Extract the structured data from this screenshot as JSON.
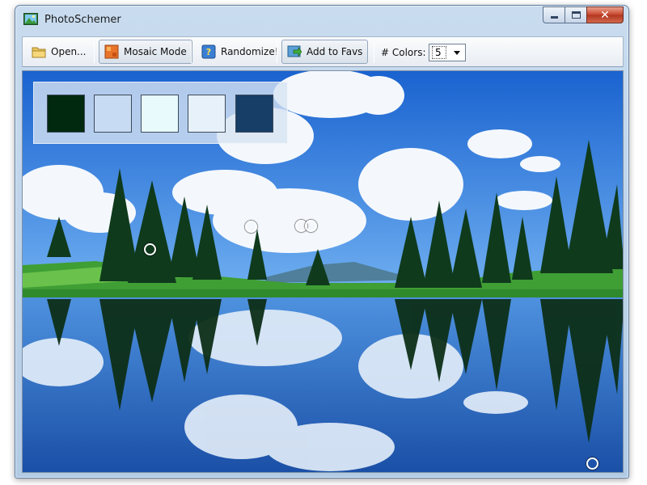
{
  "window": {
    "title": "PhotoSchemer",
    "app_icon": "picture-icon"
  },
  "caption_buttons": {
    "minimize_icon": "minimize-icon",
    "maximize_icon": "maximize-icon",
    "close_label": "✕"
  },
  "toolbar": {
    "open_label": "Open...",
    "mosaic_label": "Mosaic Mode",
    "randomize_label": "Randomize!",
    "favs_label": "Add to Favs",
    "colors_label": "# Colors:",
    "colors_value": "5"
  },
  "palette": {
    "swatches": [
      {
        "color": "#00290f"
      },
      {
        "color": "#c7dbf3"
      },
      {
        "color": "#e8fafc"
      },
      {
        "color": "#e6f1f9"
      },
      {
        "color": "#163e66"
      }
    ]
  },
  "colors": {
    "sky": "#1f6fd6",
    "water": "#1d5fb3",
    "grass": "#48a83a",
    "forest": "#0e3318"
  }
}
